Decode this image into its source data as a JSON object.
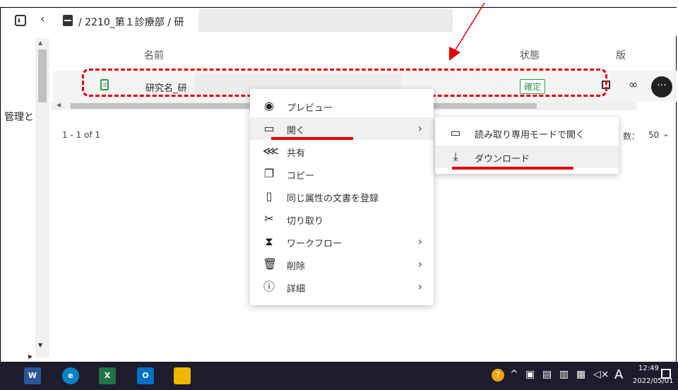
{
  "breadcrumb": {
    "path": "/ 2210_第１診療部 / 研"
  },
  "table": {
    "headers": {
      "name": "名前",
      "status": "状態",
      "version": "版"
    },
    "row": {
      "name": "研究名_研",
      "status": "確定"
    },
    "pagination": "1 - 1 of 1",
    "rows_per_page": {
      "label": "数：",
      "value": "50"
    }
  },
  "left_label": "管理と",
  "context_menu": {
    "items": [
      {
        "label": "プレビュー",
        "icon": "eye-icon"
      },
      {
        "label": "開く",
        "icon": "laptop-icon",
        "submenu": true
      },
      {
        "label": "共有",
        "icon": "share-icon"
      },
      {
        "label": "コピー",
        "icon": "copy-icon"
      },
      {
        "label": "同じ属性の文書を登録",
        "icon": "file-add-icon"
      },
      {
        "label": "切り取り",
        "icon": "scissors-icon"
      },
      {
        "label": "ワークフロー",
        "icon": "hourglass-icon",
        "submenu": true
      },
      {
        "label": "削除",
        "icon": "trash-icon",
        "submenu": true
      },
      {
        "label": "詳細",
        "icon": "info-icon",
        "submenu": true
      }
    ]
  },
  "submenu": {
    "items": [
      {
        "label": "読み取り専用モードで開く",
        "icon": "laptop-icon"
      },
      {
        "label": "ダウンロード",
        "icon": "download-icon"
      }
    ]
  },
  "taskbar": {
    "time": "12:49",
    "date": "2022/05/01",
    "ime": "A"
  },
  "colors": {
    "annotation_red": "#e60000",
    "badge_green": "#2e9a4a",
    "taskbar_bg": "#1c1c2c"
  }
}
